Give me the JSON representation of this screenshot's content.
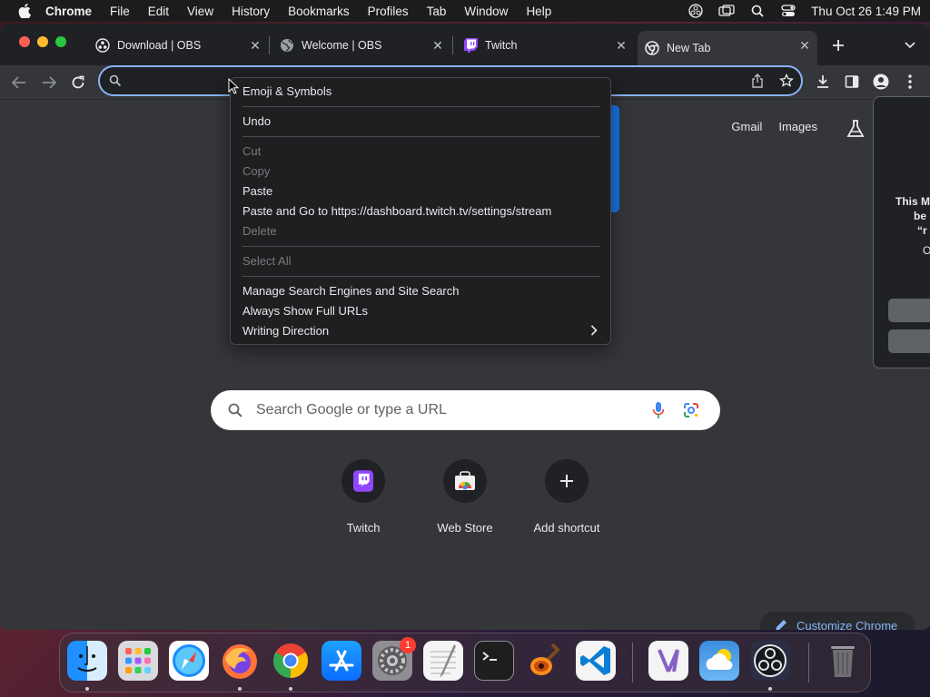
{
  "menubar": {
    "app_name": "Chrome",
    "items": [
      "File",
      "Edit",
      "View",
      "History",
      "Bookmarks",
      "Profiles",
      "Tab",
      "Window",
      "Help"
    ],
    "clock": "Thu Oct 26  1:49 PM"
  },
  "tabs": [
    {
      "title": "Download | OBS",
      "icon": "obs-icon"
    },
    {
      "title": "Welcome | OBS",
      "icon": "globe-icon"
    },
    {
      "title": "Twitch",
      "icon": "twitch-icon"
    },
    {
      "title": "New Tab",
      "icon": "chrome-icon",
      "active": true
    }
  ],
  "omnibox": {
    "value": "",
    "placeholder": ""
  },
  "context_menu": {
    "items": [
      {
        "label": "Emoji & Symbols",
        "enabled": true
      },
      {
        "label": "Undo",
        "enabled": true
      },
      {
        "label": "Cut",
        "enabled": false
      },
      {
        "label": "Copy",
        "enabled": false
      },
      {
        "label": "Paste",
        "enabled": true
      },
      {
        "label": "Paste and Go to https://dashboard.twitch.tv/settings/stream",
        "enabled": true
      },
      {
        "label": "Delete",
        "enabled": false
      },
      {
        "label": "Select All",
        "enabled": false
      },
      {
        "label": "Manage Search Engines and Site Search",
        "enabled": true
      },
      {
        "label": "Always Show Full URLs",
        "enabled": true
      },
      {
        "label": "Writing Direction",
        "enabled": true,
        "submenu": true
      }
    ]
  },
  "ntp": {
    "links": {
      "gmail": "Gmail",
      "images": "Images"
    },
    "search_placeholder": "Search Google or type a URL",
    "shortcuts": [
      {
        "label": "Twitch",
        "icon": "twitch-icon"
      },
      {
        "label": "Web Store",
        "icon": "web-store-icon"
      },
      {
        "label": "Add shortcut",
        "icon": "plus-icon"
      }
    ],
    "customize_label": "Customize Chrome"
  },
  "side_panel": {
    "lines": [
      "This M",
      "be",
      "“r",
      "O"
    ]
  },
  "dock": {
    "apps": [
      "Finder",
      "Launchpad",
      "Safari",
      "Firefox",
      "Chrome",
      "App Store",
      "System Settings",
      "TextEdit",
      "Terminal",
      "GarageBand",
      "Visual Studio Code",
      "Visual Studio",
      "Weather",
      "OBS",
      "Trash"
    ],
    "settings_badge": "1"
  },
  "colors": {
    "accent": "#8ab4f8",
    "page_bg": "#35363a",
    "tabstrip_bg": "#202124",
    "menu_bg": "#1f1f21",
    "badge_red": "#ff3b30"
  }
}
